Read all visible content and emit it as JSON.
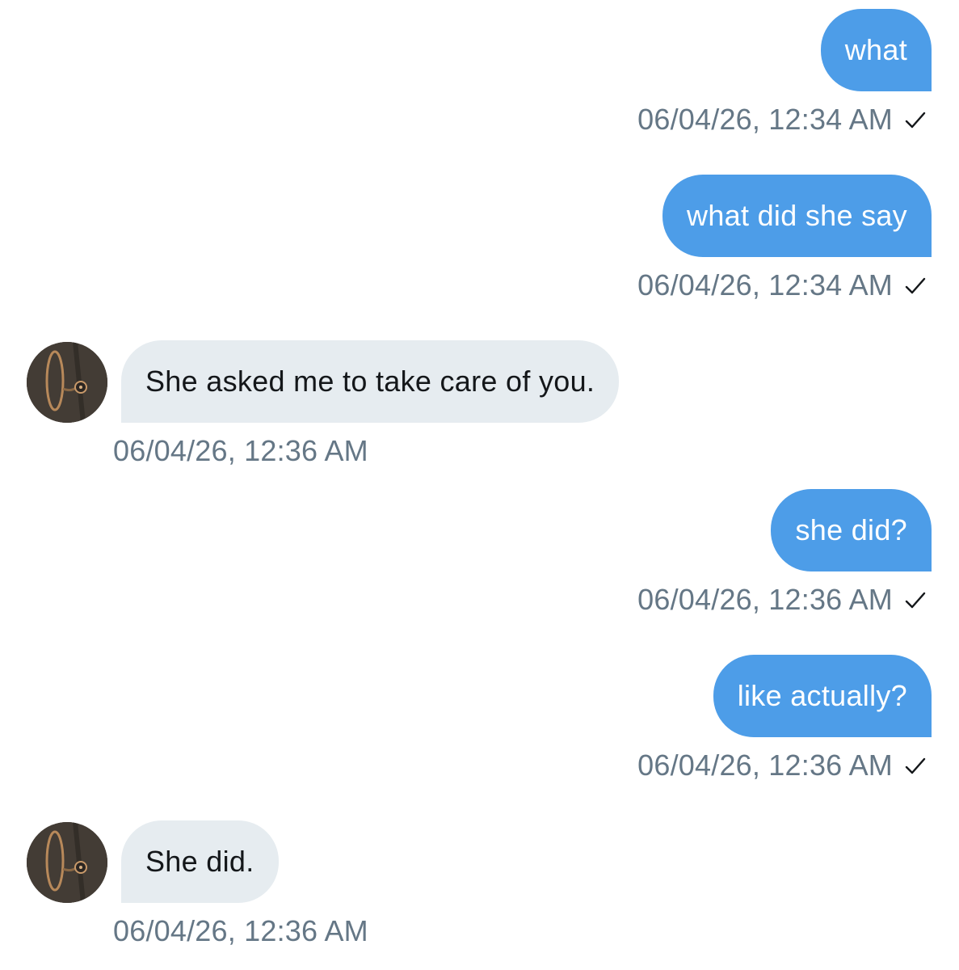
{
  "messages": [
    {
      "direction": "sent",
      "text": "what",
      "timestamp": "06/04/26, 12:34 AM",
      "read_icon": "check-icon"
    },
    {
      "direction": "sent",
      "text": "what did she say",
      "timestamp": "06/04/26, 12:34 AM",
      "read_icon": "check-icon"
    },
    {
      "direction": "received",
      "text": "She asked me to take care of you.",
      "timestamp": "06/04/26, 12:36 AM",
      "avatar_icon": "stethoscope-avatar"
    },
    {
      "direction": "sent",
      "text": "she did?",
      "timestamp": "06/04/26, 12:36 AM",
      "read_icon": "check-icon"
    },
    {
      "direction": "sent",
      "text": "like actually?",
      "timestamp": "06/04/26, 12:36 AM",
      "read_icon": "check-icon"
    },
    {
      "direction": "received",
      "text": "She did.",
      "timestamp": "06/04/26, 12:36 AM",
      "avatar_icon": "stethoscope-avatar"
    }
  ],
  "colors": {
    "sent_bubble": "#4d9de8",
    "received_bubble": "#e6ecf0",
    "timestamp_text": "#657786",
    "received_text": "#14171a"
  }
}
